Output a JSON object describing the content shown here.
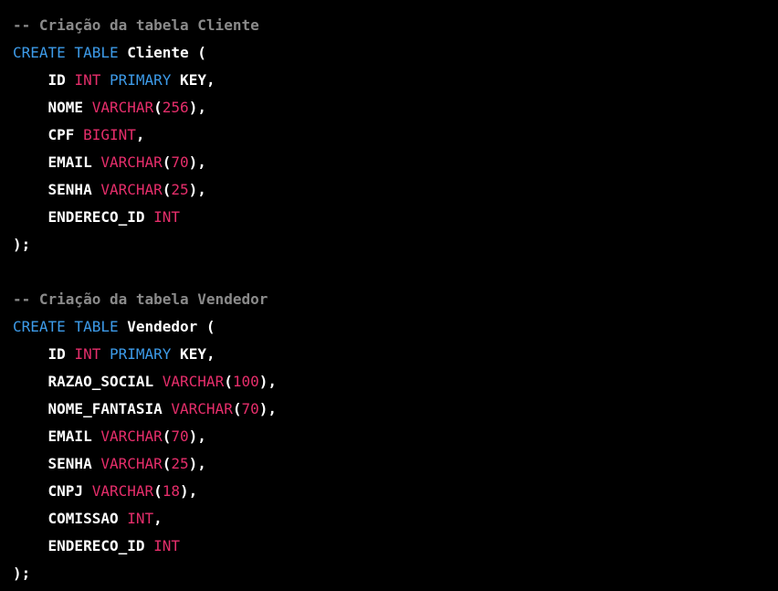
{
  "colors": {
    "background": "#000000",
    "comment": "#8a8a8a",
    "keyword": "#3d9be9",
    "type": "#e62e6b",
    "number": "#e62e6b",
    "plain": "#ffffff"
  },
  "code_lines": [
    [
      {
        "t": "comment",
        "v": "-- Criação da tabela Cliente"
      }
    ],
    [
      {
        "t": "keyword",
        "v": "CREATE TABLE"
      },
      {
        "t": "plain",
        "v": " Cliente ("
      }
    ],
    [
      {
        "t": "plain",
        "v": "    ID "
      },
      {
        "t": "type",
        "v": "INT"
      },
      {
        "t": "plain",
        "v": " "
      },
      {
        "t": "keyword",
        "v": "PRIMARY"
      },
      {
        "t": "plain",
        "v": " KEY,"
      }
    ],
    [
      {
        "t": "plain",
        "v": "    NOME "
      },
      {
        "t": "type",
        "v": "VARCHAR"
      },
      {
        "t": "plain",
        "v": "("
      },
      {
        "t": "number",
        "v": "256"
      },
      {
        "t": "plain",
        "v": "),"
      }
    ],
    [
      {
        "t": "plain",
        "v": "    CPF "
      },
      {
        "t": "type",
        "v": "BIGINT"
      },
      {
        "t": "plain",
        "v": ","
      }
    ],
    [
      {
        "t": "plain",
        "v": "    EMAIL "
      },
      {
        "t": "type",
        "v": "VARCHAR"
      },
      {
        "t": "plain",
        "v": "("
      },
      {
        "t": "number",
        "v": "70"
      },
      {
        "t": "plain",
        "v": "),"
      }
    ],
    [
      {
        "t": "plain",
        "v": "    SENHA "
      },
      {
        "t": "type",
        "v": "VARCHAR"
      },
      {
        "t": "plain",
        "v": "("
      },
      {
        "t": "number",
        "v": "25"
      },
      {
        "t": "plain",
        "v": "),"
      }
    ],
    [
      {
        "t": "plain",
        "v": "    ENDERECO_ID "
      },
      {
        "t": "type",
        "v": "INT"
      }
    ],
    [
      {
        "t": "plain",
        "v": ");"
      }
    ],
    [],
    [
      {
        "t": "comment",
        "v": "-- Criação da tabela Vendedor"
      }
    ],
    [
      {
        "t": "keyword",
        "v": "CREATE TABLE"
      },
      {
        "t": "plain",
        "v": " Vendedor ("
      }
    ],
    [
      {
        "t": "plain",
        "v": "    ID "
      },
      {
        "t": "type",
        "v": "INT"
      },
      {
        "t": "plain",
        "v": " "
      },
      {
        "t": "keyword",
        "v": "PRIMARY"
      },
      {
        "t": "plain",
        "v": " KEY,"
      }
    ],
    [
      {
        "t": "plain",
        "v": "    RAZAO_SOCIAL "
      },
      {
        "t": "type",
        "v": "VARCHAR"
      },
      {
        "t": "plain",
        "v": "("
      },
      {
        "t": "number",
        "v": "100"
      },
      {
        "t": "plain",
        "v": "),"
      }
    ],
    [
      {
        "t": "plain",
        "v": "    NOME_FANTASIA "
      },
      {
        "t": "type",
        "v": "VARCHAR"
      },
      {
        "t": "plain",
        "v": "("
      },
      {
        "t": "number",
        "v": "70"
      },
      {
        "t": "plain",
        "v": "),"
      }
    ],
    [
      {
        "t": "plain",
        "v": "    EMAIL "
      },
      {
        "t": "type",
        "v": "VARCHAR"
      },
      {
        "t": "plain",
        "v": "("
      },
      {
        "t": "number",
        "v": "70"
      },
      {
        "t": "plain",
        "v": "),"
      }
    ],
    [
      {
        "t": "plain",
        "v": "    SENHA "
      },
      {
        "t": "type",
        "v": "VARCHAR"
      },
      {
        "t": "plain",
        "v": "("
      },
      {
        "t": "number",
        "v": "25"
      },
      {
        "t": "plain",
        "v": "),"
      }
    ],
    [
      {
        "t": "plain",
        "v": "    CNPJ "
      },
      {
        "t": "type",
        "v": "VARCHAR"
      },
      {
        "t": "plain",
        "v": "("
      },
      {
        "t": "number",
        "v": "18"
      },
      {
        "t": "plain",
        "v": "),"
      }
    ],
    [
      {
        "t": "plain",
        "v": "    COMISSAO "
      },
      {
        "t": "type",
        "v": "INT"
      },
      {
        "t": "plain",
        "v": ","
      }
    ],
    [
      {
        "t": "plain",
        "v": "    ENDERECO_ID "
      },
      {
        "t": "type",
        "v": "INT"
      }
    ],
    [
      {
        "t": "plain",
        "v": ");"
      }
    ]
  ]
}
